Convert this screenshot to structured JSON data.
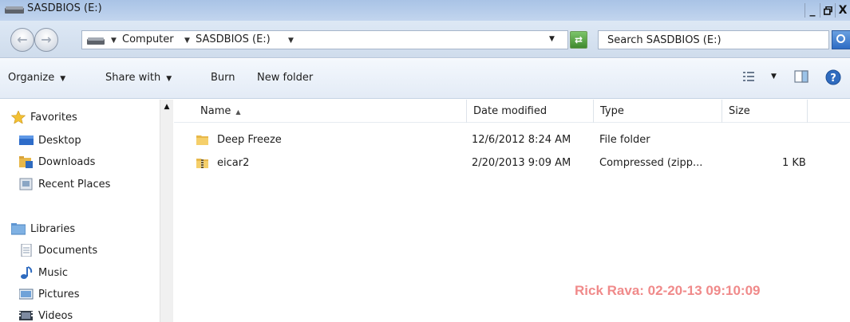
{
  "window": {
    "title": "SASDBIOS (E:)",
    "controls": {
      "minimize": "_",
      "restore": "□",
      "close": "X"
    }
  },
  "address": {
    "crumbs": [
      "Computer",
      "SASDBIOS (E:)"
    ],
    "search_placeholder": "Search SASDBIOS (E:)"
  },
  "toolbar": {
    "organize": "Organize",
    "share_with": "Share with",
    "burn": "Burn",
    "new_folder": "New folder"
  },
  "nav": {
    "favorites": {
      "label": "Favorites",
      "items": [
        "Desktop",
        "Downloads",
        "Recent Places"
      ]
    },
    "libraries": {
      "label": "Libraries",
      "items": [
        "Documents",
        "Music",
        "Pictures",
        "Videos"
      ]
    }
  },
  "columns": {
    "name": "Name",
    "date_modified": "Date modified",
    "type": "Type",
    "size": "Size"
  },
  "files": [
    {
      "name": "Deep Freeze",
      "date_modified": "12/6/2012 8:24 AM",
      "type": "File folder",
      "size": "",
      "icon": "folder-icon"
    },
    {
      "name": "eicar2",
      "date_modified": "2/20/2013 9:09 AM",
      "type": "Compressed (zipp...",
      "size": "1 KB",
      "icon": "zip-folder-icon"
    }
  ],
  "watermark": "Rick Rava: 02-20-13 09:10:09",
  "colors": {
    "titlebar": "#b4cbe9",
    "watermark": "#f08a8a",
    "folder": "#e8b84a"
  }
}
